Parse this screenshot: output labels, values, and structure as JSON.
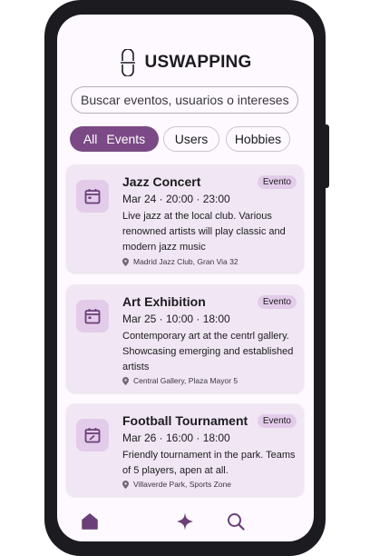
{
  "app": {
    "title": "USWAPPING",
    "logo_icon": "swap-logo-icon"
  },
  "search": {
    "placeholder": "Buscar eventos, usuarios o intereses"
  },
  "filters": {
    "all_label": "All",
    "events_label": "Events",
    "users_label": "Users",
    "hobbies_label": "Hobbies",
    "selected": "All Events",
    "accent_color": "#7b4a86"
  },
  "events": [
    {
      "title": "Jazz Concert",
      "badge": "Evento",
      "date": "Mar 24 · 20:00 · 23:00",
      "description": "Live jazz at the local club. Various renowned artists will play classic and modern jazz music",
      "location": "Madrid Jazz Club, Gran Via 32",
      "icon": "calendar-icon"
    },
    {
      "title": "Art Exhibition",
      "badge": "Evento",
      "date": "Mar 25 · 10:00 · 18:00",
      "description": "Contemporary art at the centrl gallery. Showcasing emerging and established artists",
      "location": "Central Gallery, Plaza Mayor 5",
      "icon": "calendar-icon"
    },
    {
      "title": "Football Tournament",
      "badge": "Evento",
      "date": "Mar 26 · 16:00 · 18:00",
      "description": "Friendly tournament in the park. Teams of 5 players, apen at all.",
      "location": "Villaverde Park, Sports Zone",
      "icon": "calendar-edit-icon"
    }
  ],
  "nav": {
    "items": [
      "home-icon",
      "sparkle-icon",
      "search-icon"
    ]
  }
}
